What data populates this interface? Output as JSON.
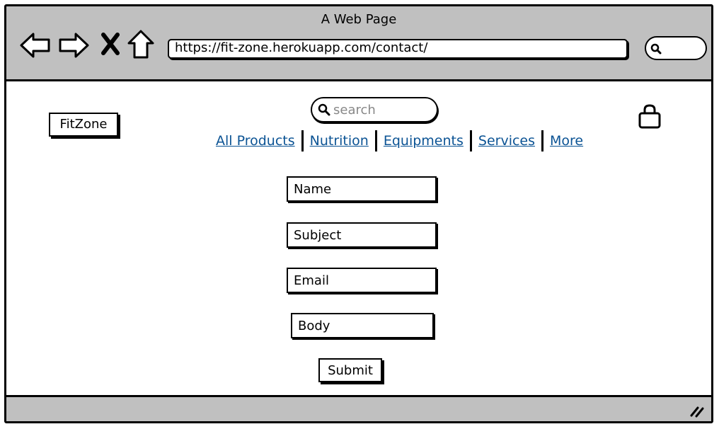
{
  "window": {
    "title": "A Web Page"
  },
  "browser": {
    "url": "https://fit-zone.herokuapp.com/contact/",
    "icons": [
      "back-arrow-icon",
      "forward-arrow-icon",
      "close-icon",
      "home-icon",
      "search-icon"
    ]
  },
  "site": {
    "logo": "FitZone",
    "search": {
      "placeholder": "search"
    },
    "cart_icon": "shopping-bag-icon",
    "nav": [
      {
        "label": "All Products"
      },
      {
        "label": "Nutrition"
      },
      {
        "label": "Equipments"
      },
      {
        "label": "Services"
      },
      {
        "label": "More"
      }
    ]
  },
  "form": {
    "name_placeholder": "Name",
    "subject_placeholder": "Subject",
    "email_placeholder": "Email",
    "body_placeholder": "Body",
    "submit_label": "Submit"
  },
  "colors": {
    "chrome": "#c0c0c0",
    "link": "#0b5394"
  }
}
